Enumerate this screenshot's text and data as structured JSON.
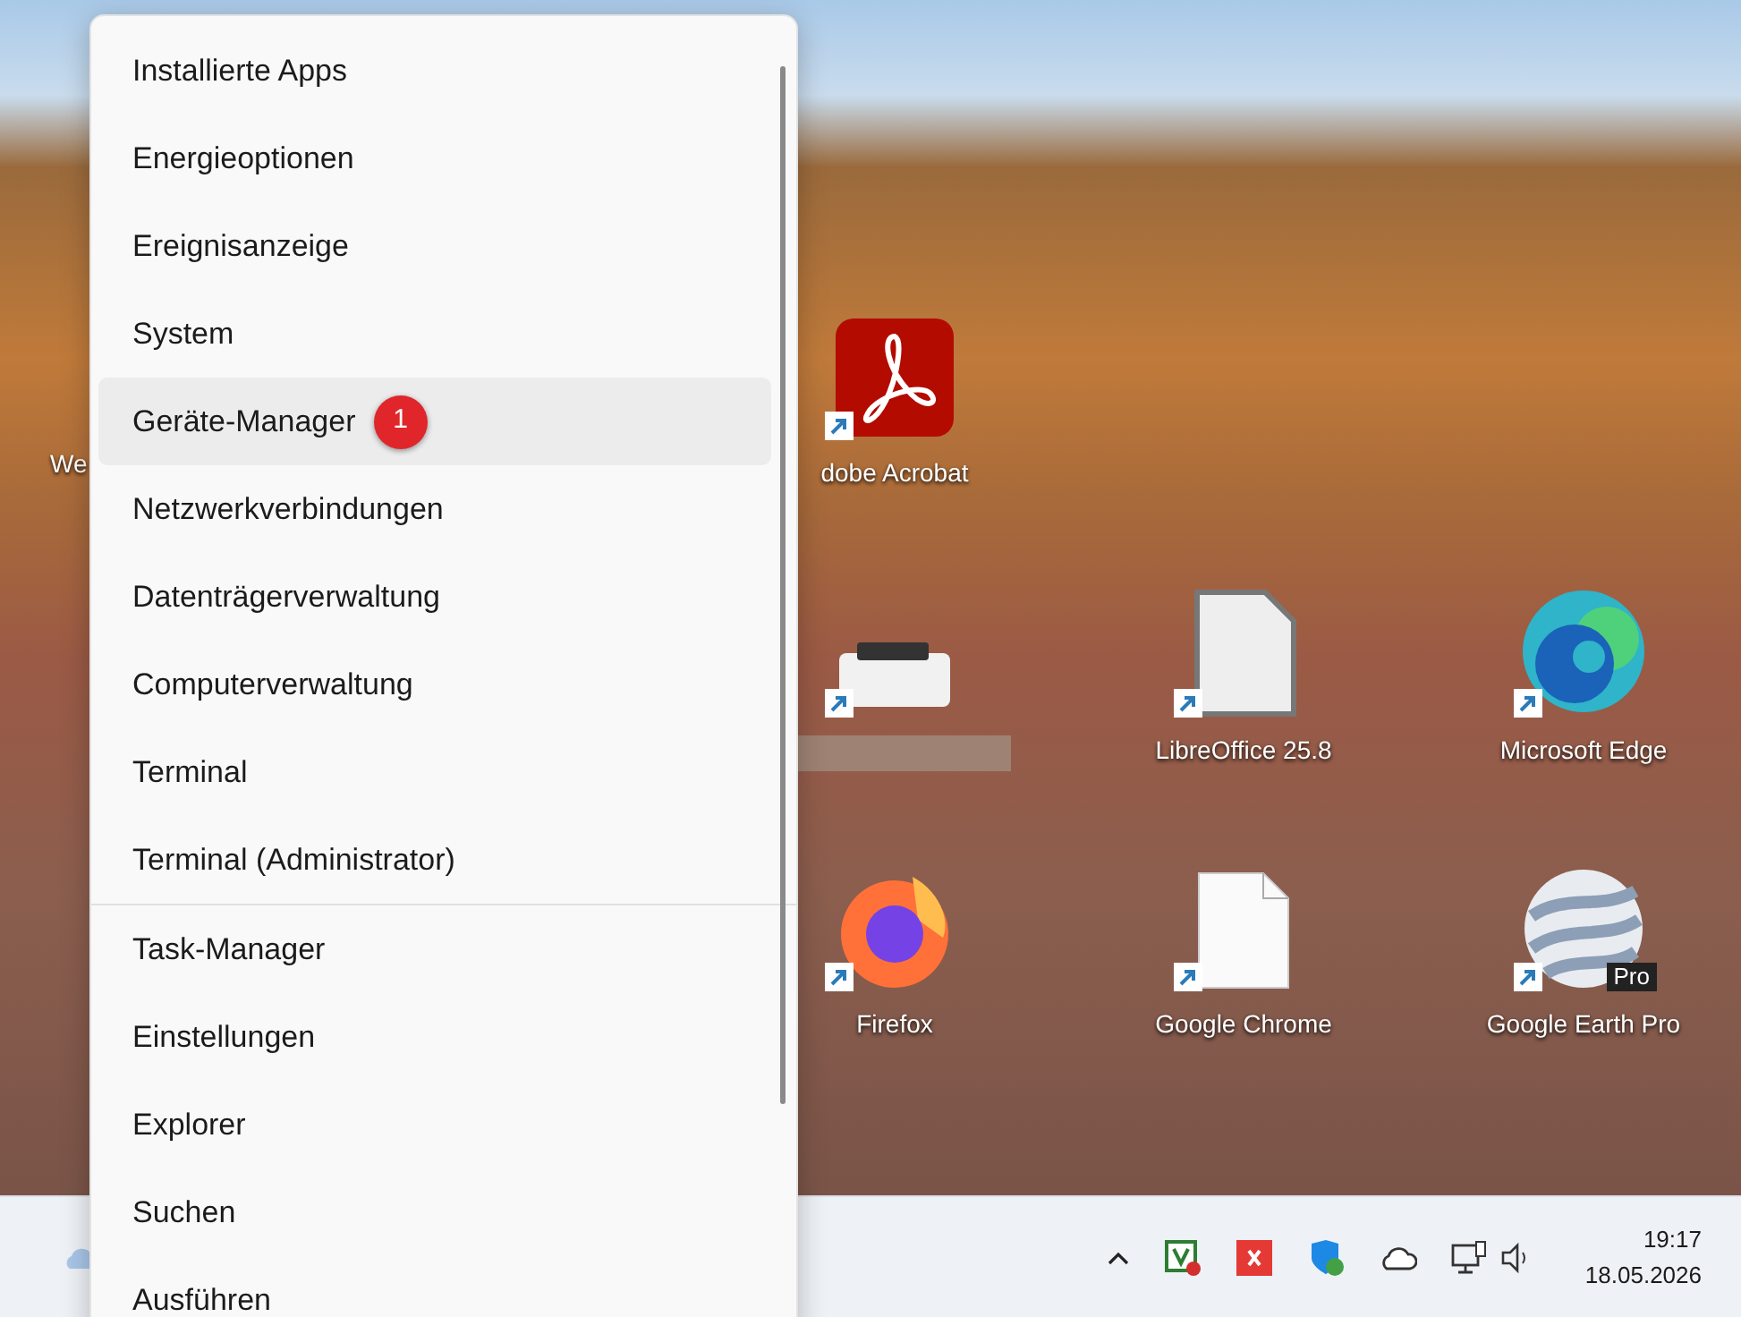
{
  "desktop_icons": [
    {
      "kind": "partial",
      "label": "We"
    },
    {
      "kind": "acrobat",
      "label": "dobe Acrobat"
    },
    {
      "kind": "printer"
    },
    {
      "kind": "libreoffice",
      "label": "LibreOffice 25.8"
    },
    {
      "kind": "edge",
      "label": "Microsoft Edge"
    },
    {
      "kind": "firefox",
      "label": "Firefox"
    },
    {
      "kind": "file",
      "label": "Google Chrome"
    },
    {
      "kind": "earth",
      "label": "Google Earth Pro",
      "tag": "Pro"
    }
  ],
  "context_menu": {
    "items": [
      {
        "label": "Installierte Apps",
        "selected": false,
        "separator_after": false
      },
      {
        "label": "Energieoptionen",
        "selected": false,
        "separator_after": false
      },
      {
        "label": "Ereignisanzeige",
        "selected": false,
        "separator_after": false
      },
      {
        "label": "System",
        "selected": false,
        "separator_after": false
      },
      {
        "label": "Geräte-Manager",
        "selected": true,
        "separator_after": false,
        "badge": "1"
      },
      {
        "label": "Netzwerkverbindungen",
        "selected": false,
        "separator_after": false
      },
      {
        "label": "Datenträgerverwaltung",
        "selected": false,
        "separator_after": false
      },
      {
        "label": "Computerverwaltung",
        "selected": false,
        "separator_after": false
      },
      {
        "label": "Terminal",
        "selected": false,
        "separator_after": false
      },
      {
        "label": "Terminal (Administrator)",
        "selected": false,
        "separator_after": true
      },
      {
        "label": "Task-Manager",
        "selected": false,
        "separator_after": false
      },
      {
        "label": "Einstellungen",
        "selected": false,
        "separator_after": false
      },
      {
        "label": "Explorer",
        "selected": false,
        "separator_after": false
      },
      {
        "label": "Suchen",
        "selected": false,
        "separator_after": false
      },
      {
        "label": "Ausführen",
        "selected": false,
        "separator_after": false
      }
    ]
  },
  "taskbar": {
    "time": "19:17",
    "date": "18.05.2026"
  }
}
